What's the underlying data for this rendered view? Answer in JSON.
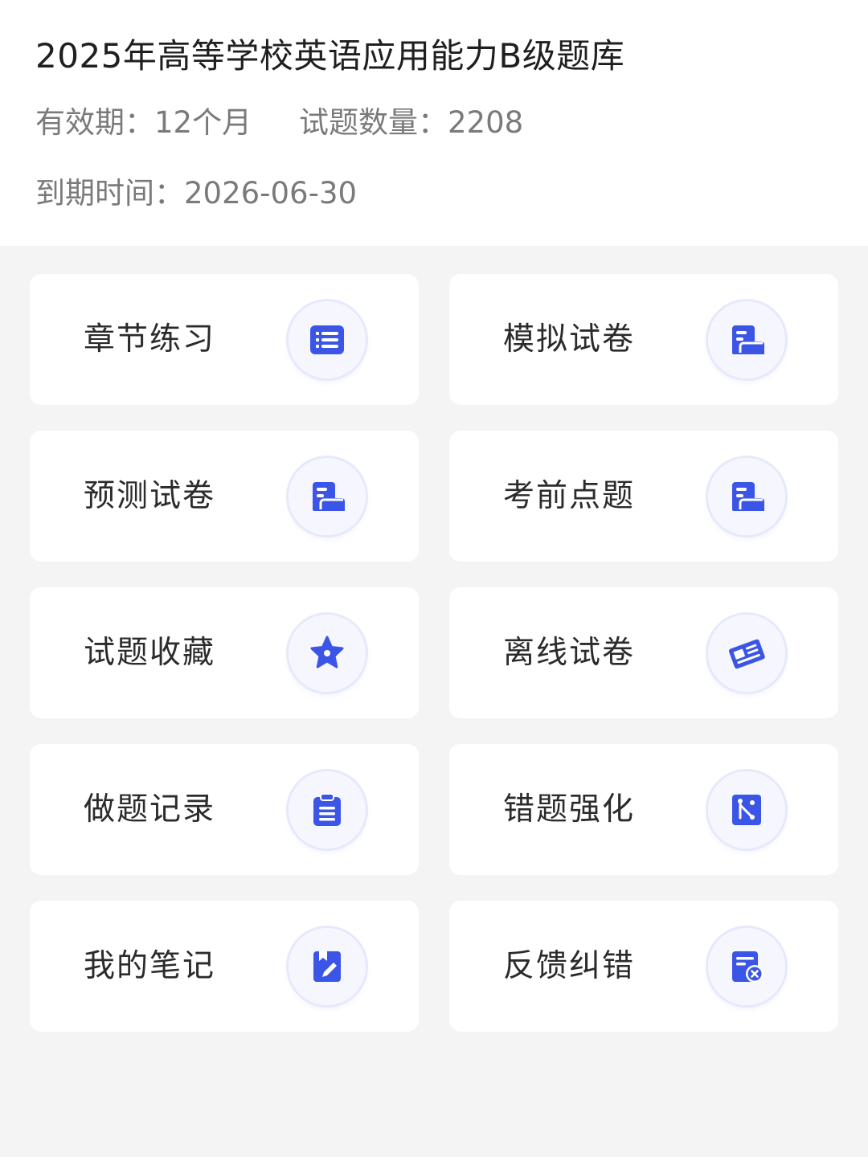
{
  "header": {
    "title": "2025年高等学校英语应用能力B级题库",
    "validity": "有效期：12个月",
    "question_count": "试题数量：2208",
    "expiry": "到期时间：2026-06-30"
  },
  "colors": {
    "accent": "#3b55e6",
    "accent_light": "#e6e9fb",
    "page_background": "#f4f4f5",
    "card_background": "#ffffff"
  },
  "menu": [
    {
      "label": "章节练习",
      "icon": "list-icon"
    },
    {
      "label": "模拟试卷",
      "icon": "document-icon"
    },
    {
      "label": "预测试卷",
      "icon": "document-icon"
    },
    {
      "label": "考前点题",
      "icon": "document-icon"
    },
    {
      "label": "试题收藏",
      "icon": "star-icon"
    },
    {
      "label": "离线试卷",
      "icon": "newspaper-icon"
    },
    {
      "label": "做题记录",
      "icon": "clipboard-icon"
    },
    {
      "label": "错题强化",
      "icon": "branch-icon"
    },
    {
      "label": "我的笔记",
      "icon": "notebook-pen-icon"
    },
    {
      "label": "反馈纠错",
      "icon": "feedback-icon"
    }
  ]
}
